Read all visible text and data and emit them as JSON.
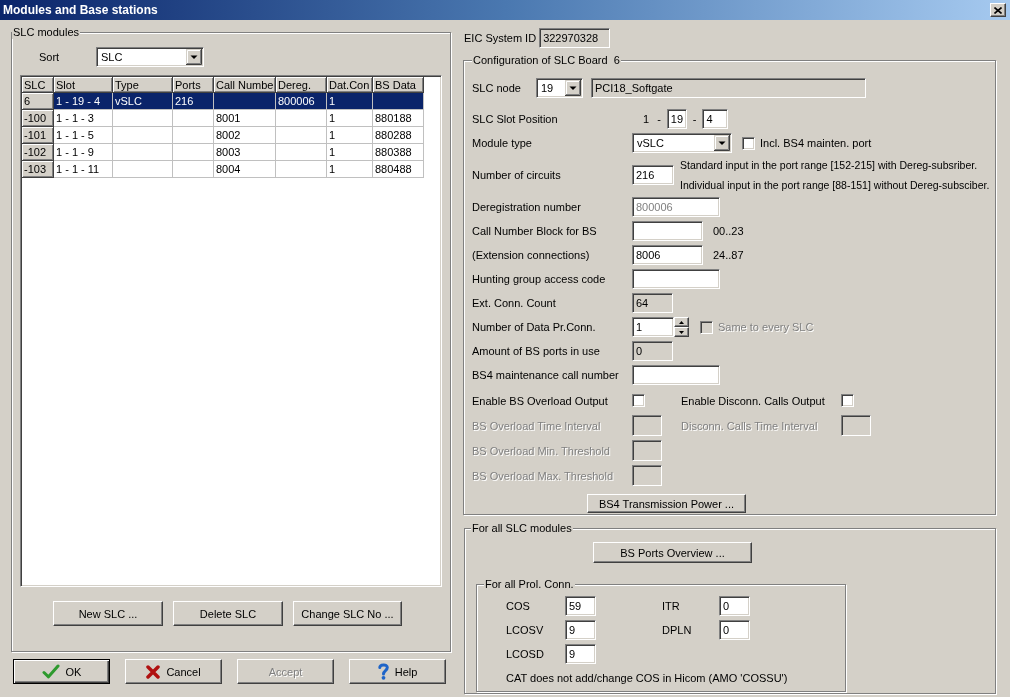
{
  "window": {
    "title": "Modules and Base stations"
  },
  "slc_modules": {
    "title": "SLC modules",
    "sort": {
      "label": "Sort",
      "value": "SLC"
    },
    "table": {
      "columns": [
        "SLC",
        "Slot",
        "Type",
        "Ports",
        "Call Numbe",
        "Dereg.",
        "Dat.Con",
        "BS Data"
      ],
      "rows": [
        {
          "selected": true,
          "slc": "6",
          "slot": "1 - 19 - 4",
          "type": "vSLC",
          "ports": "216",
          "dereg": "800006",
          "column_7": "1"
        },
        {
          "selected": false,
          "slc": "-100",
          "slot": "1 - 1 - 3",
          "column_5": "8001",
          "column_7": "1",
          "bs_data": "880188"
        },
        {
          "selected": false,
          "slc": "-101",
          "slot": "1 - 1 - 5",
          "column_5": "8002",
          "column_7": "1",
          "bs_data": "880288"
        },
        {
          "selected": false,
          "slc": "-102",
          "slot": "1 - 1 - 9",
          "column_5": "8003",
          "column_7": "1",
          "bs_data": "880388"
        },
        {
          "selected": false,
          "slc": "-103",
          "slot": "1 - 1 - 11",
          "column_5": "8004",
          "column_7": "1",
          "bs_data": "880488"
        }
      ]
    },
    "buttons": [
      "New SLC ...",
      "Delete SLC",
      "Change SLC No ..."
    ]
  },
  "dialog_buttons": [
    {
      "kind": "ok",
      "label": "OK",
      "default": true,
      "disabled": false
    },
    {
      "kind": "cancel",
      "label": "Cancel",
      "default": false,
      "disabled": false
    },
    {
      "kind": "accept",
      "label": "Accept",
      "default": false,
      "disabled": true
    },
    {
      "kind": "help",
      "label": "Help",
      "default": false,
      "disabled": false
    }
  ],
  "eic_system_id": {
    "label": "EIC System ID",
    "value": "322970328"
  },
  "configuration": {
    "title": "Configuration of SLC Board  6",
    "slc_node": {
      "label": "SLC node",
      "value": "19",
      "description": "PCI18_Softgate"
    },
    "slot_position": {
      "label": "SLC Slot Position",
      "parts": [
        {
          "kind": "fixed",
          "text": "1"
        },
        {
          "kind": "separator",
          "text": "-"
        },
        {
          "kind": "field",
          "text": "19"
        },
        {
          "kind": "separator",
          "text": "-"
        },
        {
          "kind": "field",
          "text": "4"
        }
      ]
    },
    "module_type": {
      "label": "Module type",
      "value": "vSLC",
      "option": {
        "label": "Incl. BS4 mainten. port",
        "checked": false
      }
    },
    "circuits": {
      "label": "Number of circuits",
      "value": "216",
      "notes": [
        "Standard input in the port range [152-215] with Dereg-subsriber.",
        "Individual input in the port range [88-151] without Dereg-subsciber."
      ]
    },
    "fields": [
      {
        "kind": "disabled",
        "label": "Deregistration number",
        "value": "800006"
      },
      {
        "kind": "range",
        "label": "Call Number Block for BS",
        "range": "00..23"
      },
      {
        "kind": "range",
        "label": "(Extension connections)",
        "value": "8006",
        "range": "24..87"
      },
      {
        "kind": "text",
        "label": "Hunting group access code"
      },
      {
        "kind": "readonly",
        "label": "Ext. Conn. Count",
        "value": "64"
      },
      {
        "kind": "spinner",
        "label": "Number of Data Pr.Conn.",
        "value": "1",
        "option": {
          "label": "Same to every SLC",
          "checked": false,
          "disabled": true
        }
      },
      {
        "kind": "readonly",
        "label": "Amount of BS ports in use",
        "value": "0"
      },
      {
        "kind": "text",
        "label": "BS4 maintenance call number"
      }
    ],
    "overload_rows": [
      {
        "items": [
          {
            "kind": "checkbox",
            "label": "Enable BS Overload Output",
            "checked": false,
            "disabled": false
          },
          {
            "kind": "checkbox",
            "label": "Enable Disconn. Calls Output",
            "checked": false,
            "disabled": false
          }
        ]
      },
      {
        "items": [
          {
            "kind": "field",
            "label": "BS Overload Time Interval",
            "disabled": true
          },
          {
            "kind": "field",
            "label": "Disconn. Calls Time Interval",
            "disabled": true
          }
        ]
      },
      {
        "items": [
          {
            "kind": "field",
            "label": "BS Overload Min. Threshold",
            "disabled": true
          }
        ]
      },
      {
        "items": [
          {
            "kind": "field",
            "label": "BS Overload Max. Threshold",
            "disabled": true
          }
        ]
      }
    ],
    "transmission_button": "BS4 Transmission Power ..."
  },
  "for_all": {
    "title": "For all SLC modules",
    "button": "BS Ports Overview ...",
    "prol_conn": {
      "title": "For all Prol. Conn.",
      "fields": [
        {
          "label": "COS",
          "value": "59"
        },
        {
          "label": "ITR",
          "value": "0"
        },
        {
          "label": "LCOSV",
          "value": "9"
        },
        {
          "label": "DPLN",
          "value": "0"
        },
        {
          "label": "LCOSD",
          "value": "9"
        }
      ],
      "note": "CAT does not add/change COS in Hicom (AMO 'COSSU')"
    }
  }
}
